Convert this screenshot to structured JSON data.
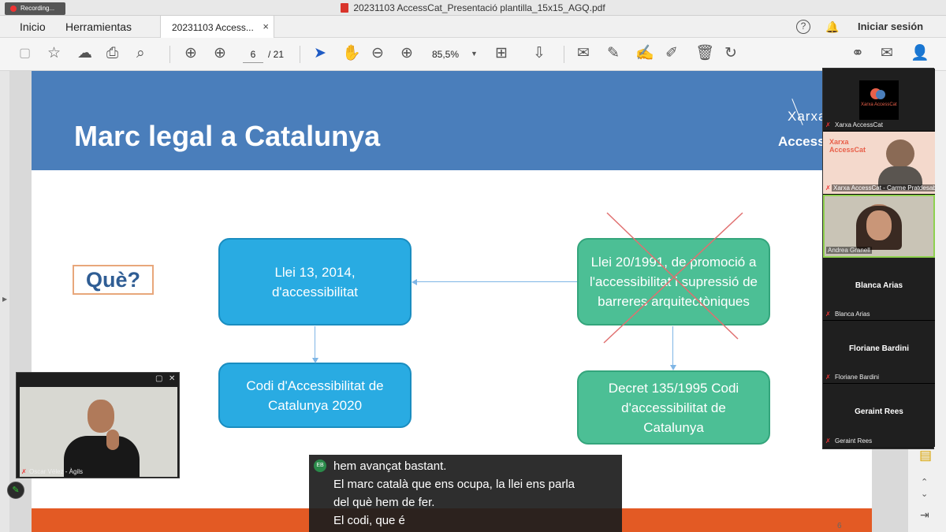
{
  "window": {
    "title": "20231103 AccessCat_Presentació plantilla_15x15_AGQ.pdf",
    "recording": "Recording..."
  },
  "menu": {
    "home": "Inicio",
    "tools": "Herramientas",
    "tab_label": "20231103 Access...",
    "tab_close": "×",
    "sign_in": "Iniciar sesión",
    "help": "?"
  },
  "toolbar": {
    "page_current": "6",
    "page_total": "/ 21",
    "zoom": "85,5%"
  },
  "slide": {
    "title": "Marc legal a Catalunya",
    "logo_top": "Xarxa",
    "logo_bottom": "Access",
    "question": "Què?",
    "box_llei13": "Llei 13, 2014, d'accessibilitat",
    "box_codi": "Codi d'Accessibilitat de Catalunya 2020",
    "box_llei20": "Llei 20/1991, de promoció a l'accessibilitat i supressió de barreres arquitectòniques",
    "box_decret": "Decret 135/1995 Codi d'accessibilitat de Catalunya",
    "page_number": "6"
  },
  "participants": [
    {
      "name": "Xarxa AccessCat",
      "logo_text": "Xarxa AccessCat"
    },
    {
      "name": "Xarxa AccessCat - Carme Pratdesaba",
      "logo_text": "Xarxa AccessCat"
    },
    {
      "name": "Andrea Granell"
    },
    {
      "name": "Blanca Arias",
      "display": "Blanca Arias"
    },
    {
      "name": "Floriane Bardini",
      "display": "Floriane Bardini"
    },
    {
      "name": "Geraint Rees",
      "display": "Geraint Rees"
    }
  ],
  "interpreter": {
    "name": "Oscar Vélez - Àgils"
  },
  "caption": {
    "speaker_initials": "EB",
    "lines": [
      "hem avançat bastant.",
      "El marc català que ens ocupa, la llei ens parla",
      "del què hem de fer.",
      "El codi, que é"
    ]
  }
}
